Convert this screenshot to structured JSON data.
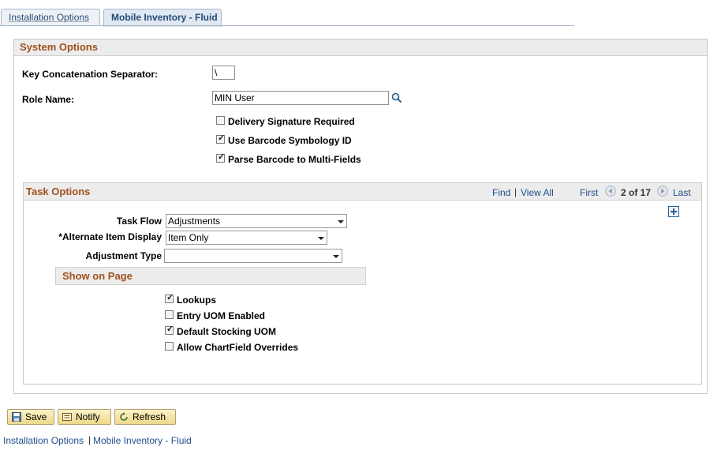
{
  "tabs": [
    {
      "label": "Installation Options"
    },
    {
      "label": "Mobile Inventory - Fluid"
    }
  ],
  "system_options": {
    "title": "System Options",
    "key_concat_label": "Key Concatenation Separator:",
    "key_concat_value": "\\",
    "role_name_label": "Role Name:",
    "role_name_value": "MIN User",
    "checkboxes": [
      {
        "label": "Delivery Signature Required",
        "checked": false
      },
      {
        "label": "Use Barcode Symbology ID",
        "checked": true
      },
      {
        "label": "Parse Barcode to Multi-Fields",
        "checked": true
      }
    ]
  },
  "task_options": {
    "title": "Task Options",
    "find": "Find",
    "view_all": "View All",
    "first": "First",
    "page_counter": "2 of 17",
    "last": "Last",
    "task_flow_label": "Task Flow",
    "task_flow_value": "Adjustments",
    "alt_item_label": "*Alternate Item Display",
    "alt_item_value": "Item Only",
    "adj_type_label": "Adjustment Type",
    "adj_type_value": "",
    "show_on_page": {
      "title": "Show on Page",
      "checkboxes": [
        {
          "label": "Lookups",
          "checked": true
        },
        {
          "label": "Entry UOM Enabled",
          "checked": false
        },
        {
          "label": "Default Stocking UOM",
          "checked": true
        },
        {
          "label": "Allow ChartField Overrides",
          "checked": false
        }
      ]
    }
  },
  "toolbar": {
    "save": "Save",
    "notify": "Notify",
    "refresh": "Refresh"
  },
  "footer_links": {
    "installation": "Installation Options",
    "separator": "|",
    "mobile": "Mobile Inventory - Fluid"
  },
  "colors": {
    "header_text": "#a0521e",
    "link": "#1f4e8c",
    "button_bg": "#eed98a"
  }
}
